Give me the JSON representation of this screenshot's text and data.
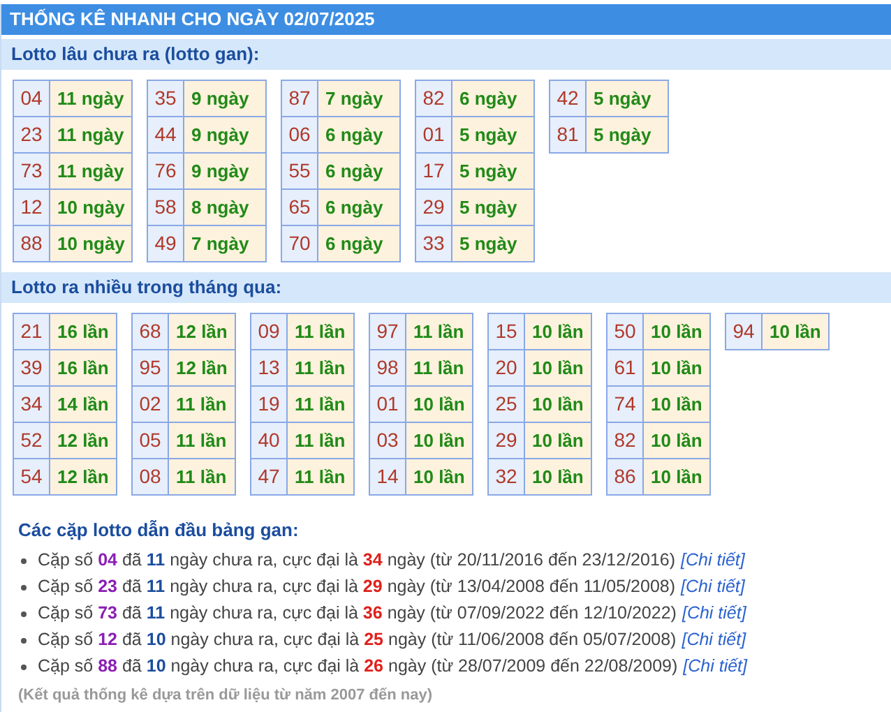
{
  "title": "THỐNG KÊ NHANH CHO NGÀY 02/07/2025",
  "gan": {
    "heading": "Lotto lâu chưa ra (lotto gan):",
    "groups": [
      [
        {
          "num": "04",
          "value": "11 ngày"
        },
        {
          "num": "23",
          "value": "11 ngày"
        },
        {
          "num": "73",
          "value": "11 ngày"
        },
        {
          "num": "12",
          "value": "10 ngày"
        },
        {
          "num": "88",
          "value": "10 ngày"
        }
      ],
      [
        {
          "num": "35",
          "value": "9 ngày"
        },
        {
          "num": "44",
          "value": "9 ngày"
        },
        {
          "num": "76",
          "value": "9 ngày"
        },
        {
          "num": "58",
          "value": "8 ngày"
        },
        {
          "num": "49",
          "value": "7 ngày"
        }
      ],
      [
        {
          "num": "87",
          "value": "7 ngày"
        },
        {
          "num": "06",
          "value": "6 ngày"
        },
        {
          "num": "55",
          "value": "6 ngày"
        },
        {
          "num": "65",
          "value": "6 ngày"
        },
        {
          "num": "70",
          "value": "6 ngày"
        }
      ],
      [
        {
          "num": "82",
          "value": "6 ngày"
        },
        {
          "num": "01",
          "value": "5 ngày"
        },
        {
          "num": "17",
          "value": "5 ngày"
        },
        {
          "num": "29",
          "value": "5 ngày"
        },
        {
          "num": "33",
          "value": "5 ngày"
        }
      ],
      [
        {
          "num": "42",
          "value": "5 ngày"
        },
        {
          "num": "81",
          "value": "5 ngày"
        }
      ]
    ]
  },
  "frequent": {
    "heading": "Lotto ra nhiều trong tháng qua:",
    "groups": [
      [
        {
          "num": "21",
          "value": "16 lần"
        },
        {
          "num": "39",
          "value": "16 lần"
        },
        {
          "num": "34",
          "value": "14 lần"
        },
        {
          "num": "52",
          "value": "12 lần"
        },
        {
          "num": "54",
          "value": "12 lần"
        }
      ],
      [
        {
          "num": "68",
          "value": "12 lần"
        },
        {
          "num": "95",
          "value": "12 lần"
        },
        {
          "num": "02",
          "value": "11 lần"
        },
        {
          "num": "05",
          "value": "11 lần"
        },
        {
          "num": "08",
          "value": "11 lần"
        }
      ],
      [
        {
          "num": "09",
          "value": "11 lần"
        },
        {
          "num": "13",
          "value": "11 lần"
        },
        {
          "num": "19",
          "value": "11 lần"
        },
        {
          "num": "40",
          "value": "11 lần"
        },
        {
          "num": "47",
          "value": "11 lần"
        }
      ],
      [
        {
          "num": "97",
          "value": "11 lần"
        },
        {
          "num": "98",
          "value": "11 lần"
        },
        {
          "num": "01",
          "value": "10 lần"
        },
        {
          "num": "03",
          "value": "10 lần"
        },
        {
          "num": "14",
          "value": "10 lần"
        }
      ],
      [
        {
          "num": "15",
          "value": "10 lần"
        },
        {
          "num": "20",
          "value": "10 lần"
        },
        {
          "num": "25",
          "value": "10 lần"
        },
        {
          "num": "29",
          "value": "10 lần"
        },
        {
          "num": "32",
          "value": "10 lần"
        }
      ],
      [
        {
          "num": "50",
          "value": "10 lần"
        },
        {
          "num": "61",
          "value": "10 lần"
        },
        {
          "num": "74",
          "value": "10 lần"
        },
        {
          "num": "82",
          "value": "10 lần"
        },
        {
          "num": "86",
          "value": "10 lần"
        }
      ],
      [
        {
          "num": "94",
          "value": "10 lần"
        }
      ]
    ]
  },
  "leaders": {
    "heading": "Các cặp lotto dẫn đầu bảng gan:",
    "items": [
      {
        "prefix": "Cặp số",
        "pair": "04",
        "mid": "đã",
        "days": "11",
        "mid2": "ngày chưa ra, cực đại là",
        "max": "34",
        "suffix": "ngày (từ 20/11/2016 đến 23/12/2016)",
        "link": "[Chi tiết]"
      },
      {
        "prefix": "Cặp số",
        "pair": "23",
        "mid": "đã",
        "days": "11",
        "mid2": "ngày chưa ra, cực đại là",
        "max": "29",
        "suffix": "ngày (từ 13/04/2008 đến 11/05/2008)",
        "link": "[Chi tiết]"
      },
      {
        "prefix": "Cặp số",
        "pair": "73",
        "mid": "đã",
        "days": "11",
        "mid2": "ngày chưa ra, cực đại là",
        "max": "36",
        "suffix": "ngày (từ 07/09/2022 đến 12/10/2022)",
        "link": "[Chi tiết]"
      },
      {
        "prefix": "Cặp số",
        "pair": "12",
        "mid": "đã",
        "days": "10",
        "mid2": "ngày chưa ra, cực đại là",
        "max": "25",
        "suffix": "ngày (từ 11/06/2008 đến 05/07/2008)",
        "link": "[Chi tiết]"
      },
      {
        "prefix": "Cặp số",
        "pair": "88",
        "mid": "đã",
        "days": "10",
        "mid2": "ngày chưa ra, cực đại là",
        "max": "26",
        "suffix": "ngày (từ 28/07/2009 đến 22/08/2009)",
        "link": "[Chi tiết]"
      }
    ],
    "note": "(Kết quả thống kê dựa trên dữ liệu từ năm 2007 đến nay)"
  }
}
